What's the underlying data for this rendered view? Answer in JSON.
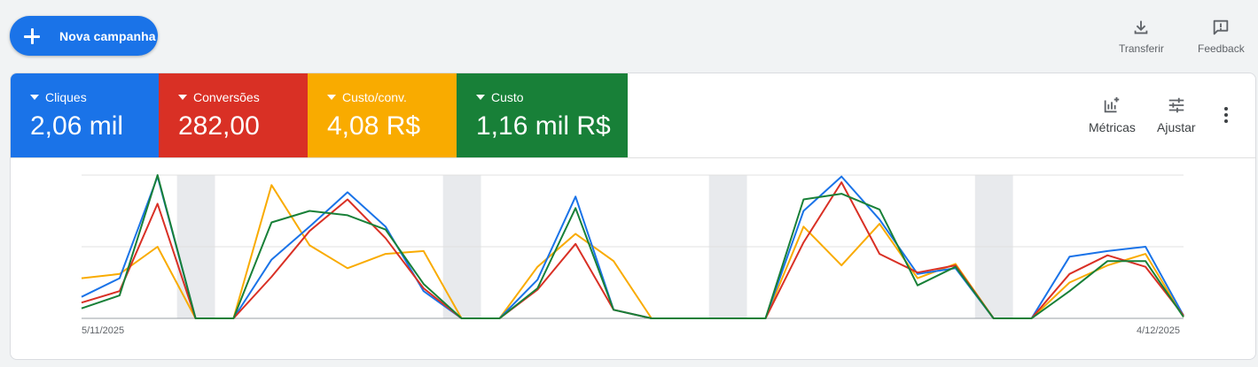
{
  "toolbar": {
    "new_campaign_label": "Nova campanha",
    "download_label": "Transferir",
    "feedback_label": "Feedback"
  },
  "scorecards": [
    {
      "name": "Cliques",
      "value": "2,06 mil",
      "color": "#1a73e8"
    },
    {
      "name": "Conversões",
      "value": "282,00",
      "color": "#d93025"
    },
    {
      "name": "Custo/conv.",
      "value": "4,08 R$",
      "color": "#f9ab00"
    },
    {
      "name": "Custo",
      "value": "1,16 mil R$",
      "color": "#188038"
    }
  ],
  "chart_tools": {
    "metrics_label": "Métricas",
    "adjust_label": "Ajustar"
  },
  "chart_data": {
    "type": "line",
    "x_start_label": "5/11/2025",
    "x_end_label": "4/12/2025",
    "y_scale": "relative (0–100, no numeric axis shown)",
    "grid": "horizontal lines",
    "shaded_days": [
      3,
      10,
      17,
      24
    ],
    "series": [
      {
        "name": "Cliques",
        "color": "#1a73e8",
        "values": [
          15,
          28,
          99,
          0,
          0,
          41,
          64,
          88,
          64,
          19,
          0,
          0,
          27,
          85,
          6,
          0,
          0,
          0,
          0,
          75,
          99,
          69,
          31,
          35,
          0,
          0,
          43,
          47,
          50,
          2
        ]
      },
      {
        "name": "Conversões",
        "color": "#d93025",
        "values": [
          11,
          19,
          80,
          0,
          0,
          29,
          61,
          83,
          56,
          21,
          0,
          0,
          20,
          52,
          6,
          0,
          0,
          0,
          0,
          53,
          95,
          45,
          32,
          37,
          0,
          0,
          31,
          44,
          36,
          2
        ]
      },
      {
        "name": "Custo/conv.",
        "color": "#f9ab00",
        "values": [
          28,
          31,
          50,
          0,
          0,
          93,
          51,
          35,
          45,
          47,
          0,
          0,
          36,
          59,
          40,
          0,
          0,
          0,
          0,
          64,
          37,
          66,
          28,
          38,
          0,
          0,
          25,
          37,
          45,
          1
        ]
      },
      {
        "name": "Custo",
        "color": "#188038",
        "values": [
          7,
          16,
          100,
          0,
          0,
          67,
          75,
          72,
          62,
          24,
          0,
          0,
          21,
          77,
          6,
          0,
          0,
          0,
          0,
          83,
          87,
          76,
          23,
          36,
          0,
          0,
          19,
          40,
          40,
          1
        ]
      }
    ]
  }
}
